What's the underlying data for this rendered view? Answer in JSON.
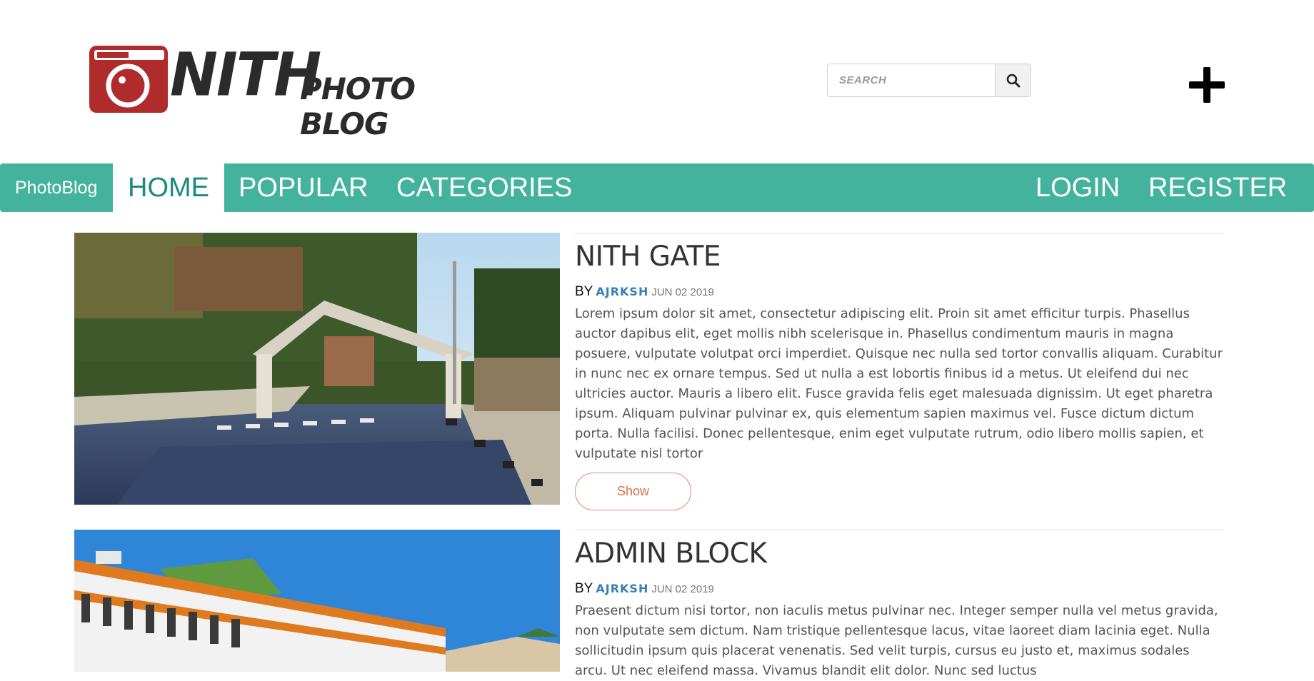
{
  "header": {
    "logo_big": "NITH",
    "logo_small": "PHOTO BLOG",
    "search_placeholder": "SEARCH"
  },
  "nav": {
    "brand": "PhotoBlog",
    "items": [
      "HOME",
      "POPULAR",
      "CATEGORIES"
    ],
    "right_items": [
      "LOGIN",
      "REGISTER"
    ],
    "active": "HOME"
  },
  "colors": {
    "nav_bg": "#44b39e",
    "accent_text": "#1a8a7e",
    "author": "#3a7fb3",
    "show_button": "#e06d4b",
    "logo_camera": "#b02c2c"
  },
  "posts": [
    {
      "title": "NITH GATE",
      "by": "BY",
      "author": "AJRKSH",
      "date": "JUN 02 2019",
      "excerpt": " Lorem ipsum dolor sit amet, consectetur adipiscing elit. Proin sit amet efficitur turpis. Phasellus auctor dapibus elit, eget mollis nibh scelerisque in. Phasellus condimentum mauris in magna posuere, vulputate volutpat orci imperdiet. Quisque nec nulla sed tortor convallis aliquam. Curabitur in nunc nec ex ornare tempus. Sed ut nulla a est lobortis finibus id a metus. Ut eleifend dui nec ultricies auctor. Mauris a libero elit.  Fusce gravida felis eget malesuada dignissim. Ut eget pharetra ipsum. Aliquam pulvinar pulvinar ex, quis elementum sapien maximus vel. Fusce dictum dictum porta. Nulla facilisi. Donec pellentesque, enim eget vulputate rutrum, odio libero mollis sapien, et vulputate nisl tortor",
      "button": "Show"
    },
    {
      "title": "ADMIN BLOCK",
      "by": "BY",
      "author": "AJRKSH",
      "date": "JUN 02 2019",
      "excerpt": " Praesent dictum nisi tortor, non iaculis metus pulvinar nec. Integer semper nulla vel metus gravida, non vulputate sem dictum. Nam tristique pellentesque lacus, vitae laoreet diam lacinia eget. Nulla sollicitudin ipsum quis placerat venenatis. Sed velit turpis, cursus eu justo et, maximus sodales arcu. Ut nec eleifend massa. Vivamus blandit elit dolor.  Nunc sed luctus"
    }
  ]
}
